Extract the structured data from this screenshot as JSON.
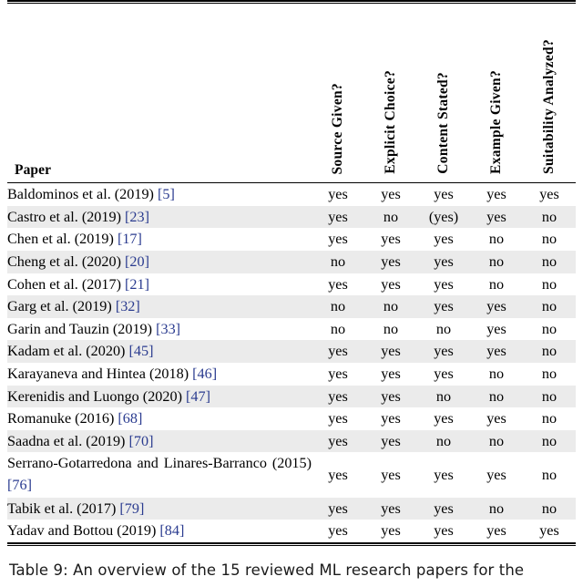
{
  "table": {
    "columns": {
      "paper_header": "Paper",
      "criteria": [
        "Source Given?",
        "Explicit Choice?",
        "Content Stated?",
        "Example Given?",
        "Suitability Analyzed?"
      ]
    },
    "rows": [
      {
        "author": "Baldominos et al. (2019)",
        "ref": "[5]",
        "values": [
          "yes",
          "yes",
          "yes",
          "yes",
          "yes"
        ]
      },
      {
        "author": "Castro et al. (2019)",
        "ref": "[23]",
        "values": [
          "yes",
          "no",
          "(yes)",
          "yes",
          "no"
        ]
      },
      {
        "author": "Chen et al. (2019)",
        "ref": "[17]",
        "values": [
          "yes",
          "yes",
          "yes",
          "no",
          "no"
        ]
      },
      {
        "author": "Cheng et al. (2020)",
        "ref": "[20]",
        "values": [
          "no",
          "yes",
          "yes",
          "no",
          "no"
        ]
      },
      {
        "author": "Cohen et al. (2017)",
        "ref": "[21]",
        "values": [
          "yes",
          "yes",
          "yes",
          "no",
          "no"
        ]
      },
      {
        "author": "Garg et al. (2019)",
        "ref": "[32]",
        "values": [
          "no",
          "no",
          "yes",
          "yes",
          "no"
        ]
      },
      {
        "author": "Garin and Tauzin (2019)",
        "ref": "[33]",
        "values": [
          "no",
          "no",
          "no",
          "yes",
          "no"
        ]
      },
      {
        "author": "Kadam et al. (2020)",
        "ref": "[45]",
        "values": [
          "yes",
          "yes",
          "yes",
          "yes",
          "no"
        ]
      },
      {
        "author": "Karayaneva and Hintea (2018)",
        "ref": "[46]",
        "values": [
          "yes",
          "yes",
          "yes",
          "no",
          "no"
        ]
      },
      {
        "author": "Kerenidis and Luongo (2020)",
        "ref": "[47]",
        "values": [
          "yes",
          "yes",
          "no",
          "no",
          "no"
        ]
      },
      {
        "author": "Romanuke (2016)",
        "ref": "[68]",
        "values": [
          "yes",
          "yes",
          "yes",
          "yes",
          "no"
        ]
      },
      {
        "author": "Saadna et al. (2019)",
        "ref": "[70]",
        "values": [
          "yes",
          "yes",
          "no",
          "no",
          "no"
        ]
      },
      {
        "author": "Serrano-Gotarredona and Linares-Barranco (2015)",
        "ref": "[76]",
        "values": [
          "yes",
          "yes",
          "yes",
          "yes",
          "no"
        ]
      },
      {
        "author": "Tabik et al. (2017)",
        "ref": "[79]",
        "values": [
          "yes",
          "yes",
          "yes",
          "no",
          "no"
        ]
      },
      {
        "author": "Yadav and Bottou (2019)",
        "ref": "[84]",
        "values": [
          "yes",
          "yes",
          "yes",
          "yes",
          "yes"
        ]
      }
    ]
  },
  "caption": {
    "text": "Table 9: An overview of the 15 reviewed ML research papers for the"
  },
  "colors": {
    "citation_link": "#2a3b8f",
    "row_shading": "#ebebeb",
    "rule": "#000000",
    "text": "#000000"
  }
}
